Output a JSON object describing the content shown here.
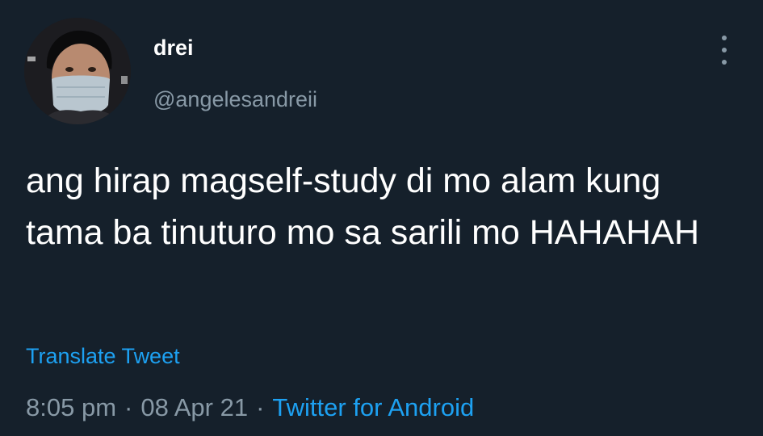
{
  "tweet": {
    "display_name": "drei",
    "handle": "@angelesandreii",
    "text": "ang hirap magself-study di mo alam kung tama ba tinuturo mo sa sarili mo HAHAHAH",
    "translate_label": "Translate Tweet",
    "time": "8:05 pm",
    "date": "08 Apr 21",
    "separator": "·",
    "source": "Twitter for Android"
  },
  "icons": {
    "more": "more-vertical-icon",
    "avatar": "profile-avatar"
  },
  "colors": {
    "background": "#15202b",
    "primary_text": "#ffffff",
    "secondary_text": "#8899a6",
    "link": "#1da1f2"
  }
}
